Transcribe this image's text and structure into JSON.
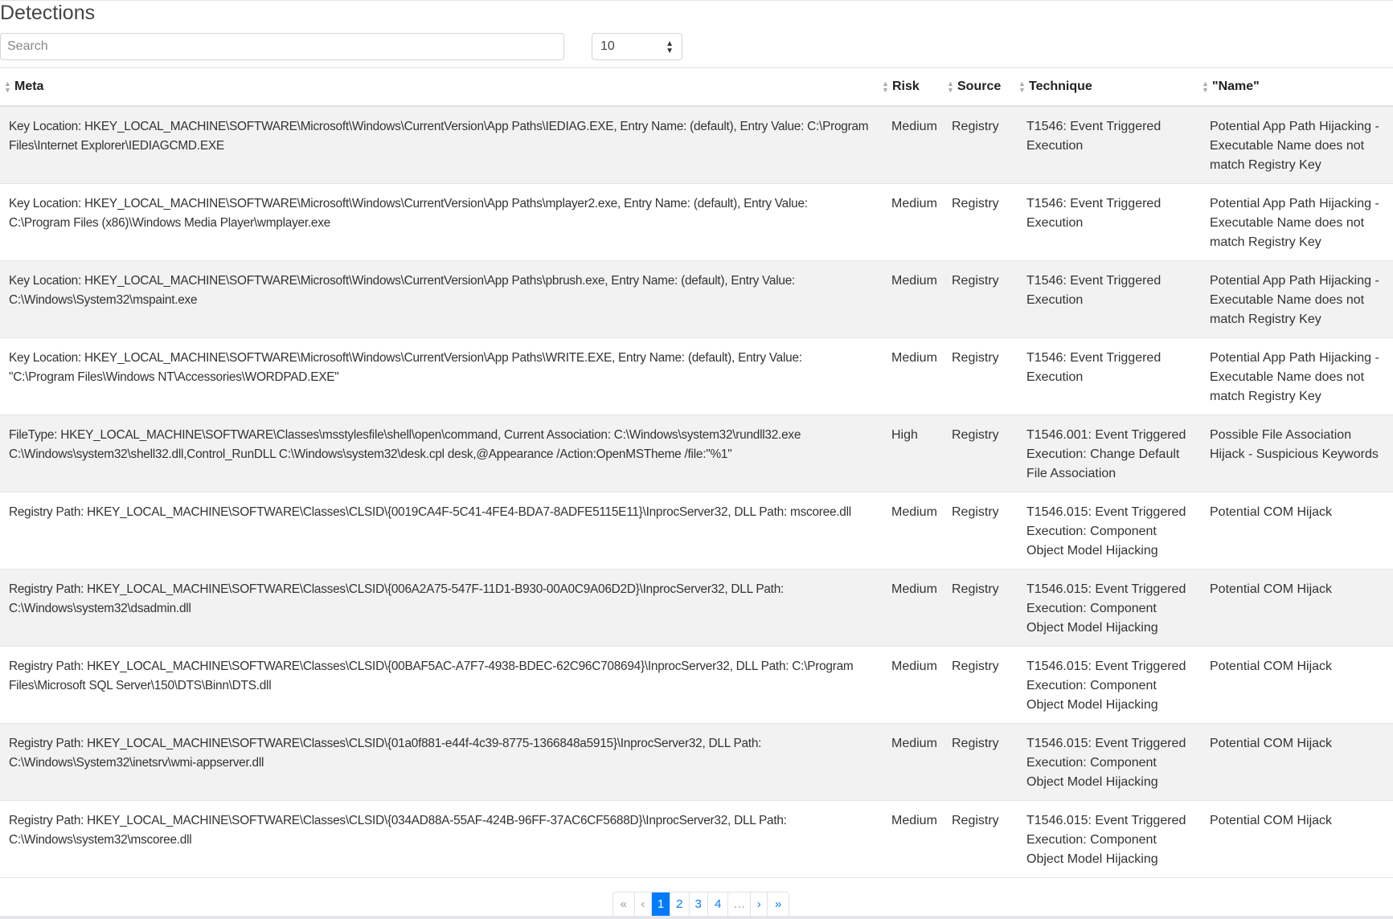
{
  "title": "Detections",
  "search": {
    "placeholder": "Search",
    "value": ""
  },
  "page_size": {
    "selected": "10"
  },
  "columns": [
    "Meta",
    "Risk",
    "Source",
    "Technique",
    "\"Name\""
  ],
  "rows": [
    {
      "meta": "Key Location: HKEY_LOCAL_MACHINE\\SOFTWARE\\Microsoft\\Windows\\CurrentVersion\\App Paths\\IEDIAG.EXE, Entry Name: (default), Entry Value: C:\\Program Files\\Internet Explorer\\IEDIAGCMD.EXE",
      "risk": "Medium",
      "source": "Registry",
      "technique": "T1546: Event Triggered Execution",
      "name": "Potential App Path Hijacking - Executable Name does not match Registry Key"
    },
    {
      "meta": "Key Location: HKEY_LOCAL_MACHINE\\SOFTWARE\\Microsoft\\Windows\\CurrentVersion\\App Paths\\mplayer2.exe, Entry Name: (default), Entry Value: C:\\Program Files (x86)\\Windows Media Player\\wmplayer.exe",
      "risk": "Medium",
      "source": "Registry",
      "technique": "T1546: Event Triggered Execution",
      "name": "Potential App Path Hijacking - Executable Name does not match Registry Key"
    },
    {
      "meta": "Key Location: HKEY_LOCAL_MACHINE\\SOFTWARE\\Microsoft\\Windows\\CurrentVersion\\App Paths\\pbrush.exe, Entry Name: (default), Entry Value: C:\\Windows\\System32\\mspaint.exe",
      "risk": "Medium",
      "source": "Registry",
      "technique": "T1546: Event Triggered Execution",
      "name": "Potential App Path Hijacking - Executable Name does not match Registry Key"
    },
    {
      "meta": "Key Location: HKEY_LOCAL_MACHINE\\SOFTWARE\\Microsoft\\Windows\\CurrentVersion\\App Paths\\WRITE.EXE, Entry Name: (default), Entry Value: \"C:\\Program Files\\Windows NT\\Accessories\\WORDPAD.EXE\"",
      "risk": "Medium",
      "source": "Registry",
      "technique": "T1546: Event Triggered Execution",
      "name": "Potential App Path Hijacking - Executable Name does not match Registry Key"
    },
    {
      "meta": "FileType: HKEY_LOCAL_MACHINE\\SOFTWARE\\Classes\\msstylesfile\\shell\\open\\command, Current Association: C:\\Windows\\system32\\rundll32.exe C:\\Windows\\system32\\shell32.dll,Control_RunDLL C:\\Windows\\system32\\desk.cpl desk,@Appearance /Action:OpenMSTheme /file:\"%1\"",
      "risk": "High",
      "source": "Registry",
      "technique": "T1546.001: Event Triggered Execution: Change Default File Association",
      "name": "Possible File Association Hijack - Suspicious Keywords"
    },
    {
      "meta": "Registry Path: HKEY_LOCAL_MACHINE\\SOFTWARE\\Classes\\CLSID\\{0019CA4F-5C41-4FE4-BDA7-8ADFE5115E11}\\InprocServer32, DLL Path: mscoree.dll",
      "risk": "Medium",
      "source": "Registry",
      "technique": "T1546.015: Event Triggered Execution: Component Object Model Hijacking",
      "name": "Potential COM Hijack"
    },
    {
      "meta": "Registry Path: HKEY_LOCAL_MACHINE\\SOFTWARE\\Classes\\CLSID\\{006A2A75-547F-11D1-B930-00A0C9A06D2D}\\InprocServer32, DLL Path: C:\\Windows\\system32\\dsadmin.dll",
      "risk": "Medium",
      "source": "Registry",
      "technique": "T1546.015: Event Triggered Execution: Component Object Model Hijacking",
      "name": "Potential COM Hijack"
    },
    {
      "meta": "Registry Path: HKEY_LOCAL_MACHINE\\SOFTWARE\\Classes\\CLSID\\{00BAF5AC-A7F7-4938-BDEC-62C96C708694}\\InprocServer32, DLL Path: C:\\Program Files\\Microsoft SQL Server\\150\\DTS\\Binn\\DTS.dll",
      "risk": "Medium",
      "source": "Registry",
      "technique": "T1546.015: Event Triggered Execution: Component Object Model Hijacking",
      "name": "Potential COM Hijack"
    },
    {
      "meta": "Registry Path: HKEY_LOCAL_MACHINE\\SOFTWARE\\Classes\\CLSID\\{01a0f881-e44f-4c39-8775-1366848a5915}\\InprocServer32, DLL Path: C:\\Windows\\System32\\inetsrv\\wmi-appserver.dll",
      "risk": "Medium",
      "source": "Registry",
      "technique": "T1546.015: Event Triggered Execution: Component Object Model Hijacking",
      "name": "Potential COM Hijack"
    },
    {
      "meta": "Registry Path: HKEY_LOCAL_MACHINE\\SOFTWARE\\Classes\\CLSID\\{034AD88A-55AF-424B-96FF-37AC6CF5688D}\\InprocServer32, DLL Path: C:\\Windows\\system32\\mscoree.dll",
      "risk": "Medium",
      "source": "Registry",
      "technique": "T1546.015: Event Triggered Execution: Component Object Model Hijacking",
      "name": "Potential COM Hijack"
    }
  ],
  "pagination": {
    "items": [
      "«",
      "‹",
      "1",
      "2",
      "3",
      "4",
      "…",
      "›",
      "»"
    ],
    "current": "1"
  },
  "colors": {
    "accent": "#007bff",
    "row_stripe": "#f2f2f2"
  },
  "icons": {
    "sort": "sort-arrows-icon",
    "select": "select-arrows-icon"
  }
}
